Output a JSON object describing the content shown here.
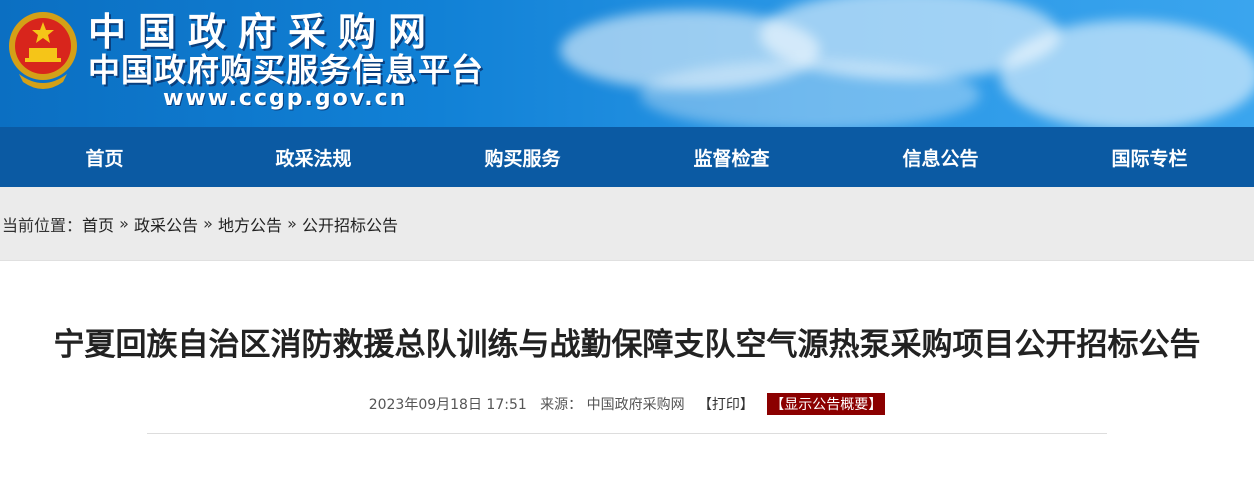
{
  "header": {
    "site_title": "中国政府采购网",
    "site_subtitle": "中国政府购买服务信息平台",
    "site_url": "www.ccgp.gov.cn"
  },
  "nav": {
    "items": [
      {
        "label": "首页"
      },
      {
        "label": "政采法规"
      },
      {
        "label": "购买服务"
      },
      {
        "label": "监督检查"
      },
      {
        "label": "信息公告"
      },
      {
        "label": "国际专栏"
      }
    ]
  },
  "breadcrumb": {
    "prefix": "当前位置：",
    "items": [
      "首页",
      "政采公告",
      "地方公告",
      "公开招标公告"
    ],
    "separator": " » "
  },
  "article": {
    "title": "宁夏回族自治区消防救援总队训练与战勤保障支队空气源热泵采购项目公开招标公告",
    "date": "2023年09月18日 17:51",
    "source_label": "来源：",
    "source": "中国政府采购网",
    "print_label": "【打印】",
    "summary_button": "【显示公告概要】"
  },
  "colors": {
    "nav_bg": "#0b5aa3",
    "banner_blue": "#1181d6",
    "summary_bg": "#8b0000"
  }
}
